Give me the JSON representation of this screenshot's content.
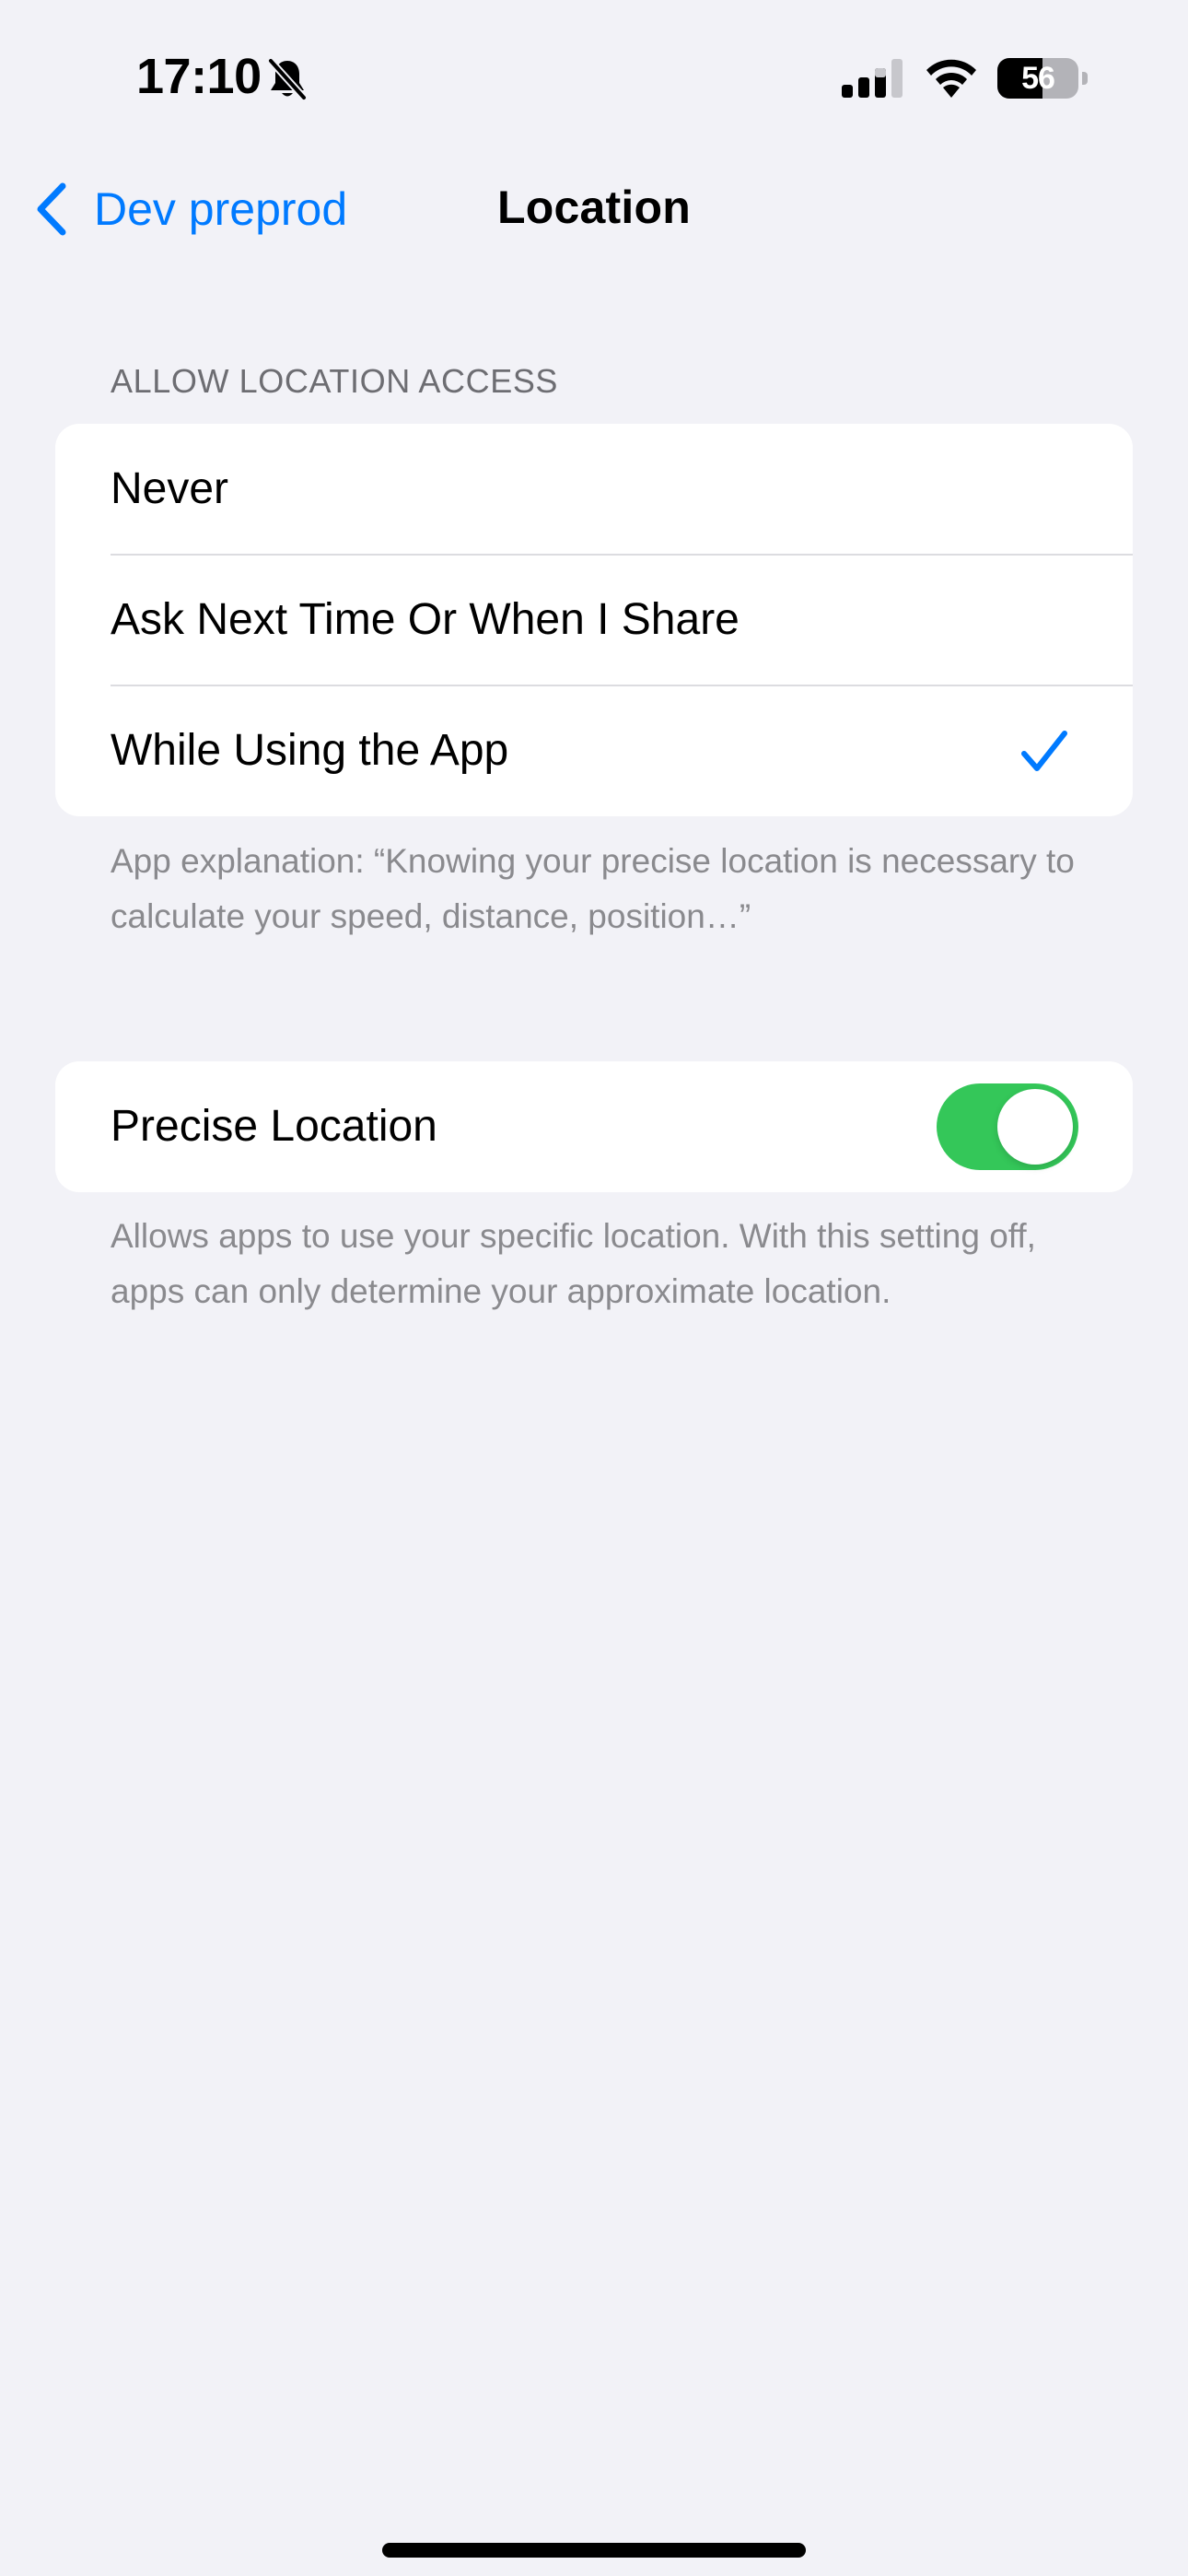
{
  "status_bar": {
    "time": "17:10",
    "battery_level": "56",
    "battery_fraction": 0.56,
    "icons": [
      "bell-slash-icon",
      "cellular-signal-icon",
      "wifi-icon",
      "battery-icon"
    ]
  },
  "nav": {
    "back_label": "Dev preprod",
    "title": "Location",
    "back_icon": "chevron-left-icon"
  },
  "location_access": {
    "header": "ALLOW LOCATION ACCESS",
    "options": [
      {
        "label": "Never",
        "selected": false
      },
      {
        "label": "Ask Next Time Or When I Share",
        "selected": false
      },
      {
        "label": "While Using the App",
        "selected": true
      }
    ],
    "footer": "App explanation: “Knowing your precise location is necessary to calculate your speed, distance, position…”"
  },
  "precise_location": {
    "label": "Precise Location",
    "enabled": true,
    "footer": "Allows apps to use your specific location. With this setting off, apps can only determine your approximate location."
  },
  "colors": {
    "accent": "#007aff",
    "toggle_on": "#34c759",
    "background": "#f2f2f7",
    "secondary_text": "#8a8a8e"
  }
}
